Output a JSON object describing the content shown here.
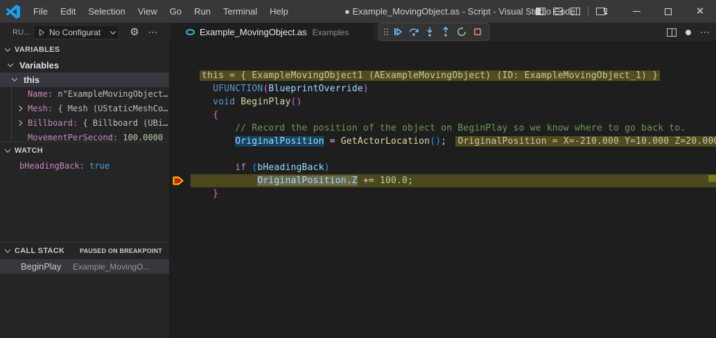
{
  "titlebar": {
    "title": "● Example_MovingObject.as - Script - Visual Studio Code",
    "menu": [
      "File",
      "Edit",
      "Selection",
      "View",
      "Go",
      "Run",
      "Terminal",
      "Help"
    ]
  },
  "run_panel": {
    "title_abbrev": "RU...",
    "config_dropdown": {
      "label": "No Configurat",
      "icons": [
        "play-outline-icon",
        "chevron-down-icon"
      ]
    },
    "actions": [
      "gear-icon",
      "ellipsis-icon"
    ]
  },
  "tab": {
    "file": "Example_MovingObject.as",
    "folder": "Examples",
    "icon": "angelscript-file-icon"
  },
  "editor_actions": [
    "split-editor-icon",
    "dirty-dot-icon",
    "ellipsis-icon"
  ],
  "debug_toolbar": {
    "icons": [
      "gripper-icon",
      "continue-icon",
      "step-over-icon",
      "step-into-icon",
      "step-out-icon",
      "restart-icon",
      "stop-icon"
    ]
  },
  "colors": {
    "titlebar_bg": "#38383a",
    "sidebar_bg": "#252526",
    "editor_bg": "#1e1e1e",
    "current_line_bg": "#4b481c",
    "inline_value_bg": "#514d1e",
    "debug_blue": "#75beff",
    "debug_green": "#89d185",
    "debug_red": "#f48771",
    "breakpoint_red": "#e51400",
    "breakpoint_arrow_yellow": "#ffcc00",
    "tab_icon_teal": "#2cc0d8"
  },
  "sidebar": {
    "variables": {
      "header": "VARIABLES",
      "rows": [
        {
          "depth": 1,
          "chevron": "down",
          "label": "Variables",
          "selected": false
        },
        {
          "depth": 2,
          "chevron": "down",
          "label": "this",
          "selected": true
        },
        {
          "depth": 3,
          "chevron": "none",
          "name": "Name:",
          "value": "n\"ExampleMovingObject…",
          "guide": true
        },
        {
          "depth": 3,
          "chevron": "right",
          "name": "Mesh:",
          "value": "{ Mesh (UStaticMeshCo…",
          "guide": true
        },
        {
          "depth": 3,
          "chevron": "right",
          "name": "Billboard:",
          "value": "{ Billboard (UBi…",
          "guide": true
        },
        {
          "depth": 3,
          "chevron": "none",
          "name": "MovementPerSecond:",
          "value": "100.0000",
          "vclass": "num",
          "guide": true
        }
      ]
    },
    "watch": {
      "header": "WATCH",
      "rows": [
        {
          "name": "bHeadingBack:",
          "value": "true",
          "vclass": "bool"
        }
      ]
    },
    "callstack": {
      "header": "CALL STACK",
      "badge": "PAUSED ON BREAKPOINT",
      "frames": [
        {
          "fn": "BeginPlay",
          "loc": "Example_MovingO..."
        }
      ]
    }
  },
  "code": {
    "lines": [
      {
        "segs": [
          [
            " ",
            "pl"
          ],
          [
            "this = { ExampleMovingObject1 (AExampleMovingObject) (ID: ExampleMovingObject_1) }",
            "ann"
          ]
        ]
      },
      {
        "segs": [
          [
            "    ",
            "pl"
          ],
          [
            "UFUNCTION",
            "kw"
          ],
          [
            "(",
            "b2"
          ],
          [
            "BlueprintOverride",
            "id"
          ],
          [
            ")",
            "b2"
          ]
        ]
      },
      {
        "segs": [
          [
            "    ",
            "pl"
          ],
          [
            "void",
            "kw"
          ],
          [
            " ",
            "pl"
          ],
          [
            "BeginPlay",
            "fn"
          ],
          [
            "()",
            "b2"
          ]
        ]
      },
      {
        "segs": [
          [
            "    ",
            "pl"
          ],
          [
            "{",
            "b2"
          ]
        ]
      },
      {
        "segs": [
          [
            "        ",
            "pl"
          ],
          [
            "// Record the position of the object on BeginPlay so we know where to go back to.",
            "cmt"
          ]
        ]
      },
      {
        "segs": [
          [
            "        ",
            "pl"
          ],
          [
            "OriginalPosition",
            "id selb"
          ],
          [
            " = ",
            "pl"
          ],
          [
            "GetActorLocation",
            "fn"
          ],
          [
            "()",
            "b3"
          ],
          [
            ";",
            "pl"
          ],
          [
            " ",
            "pl"
          ],
          [
            "OriginalPosition = X=-210.000 Y=10.000 Z=20.000",
            "ann"
          ]
        ]
      },
      {
        "segs": []
      },
      {
        "segs": [
          [
            "        ",
            "pl"
          ],
          [
            "if",
            "ctrl"
          ],
          [
            " ",
            "pl"
          ],
          [
            "(",
            "b3"
          ],
          [
            "bHeadingBack",
            "id"
          ],
          [
            ")",
            "b3"
          ]
        ]
      },
      {
        "current": true,
        "breakpoint": true,
        "segs": [
          [
            "            ",
            "pl"
          ],
          [
            "OriginalPosition",
            "id selg"
          ],
          [
            ".",
            "pl selg"
          ],
          [
            "Z",
            "id selg"
          ],
          [
            " += ",
            "pl"
          ],
          [
            "100.0",
            "num"
          ],
          [
            ";",
            "pl"
          ]
        ]
      },
      {
        "segs": [
          [
            "    ",
            "pl"
          ],
          [
            "}",
            "b2"
          ]
        ]
      }
    ]
  }
}
